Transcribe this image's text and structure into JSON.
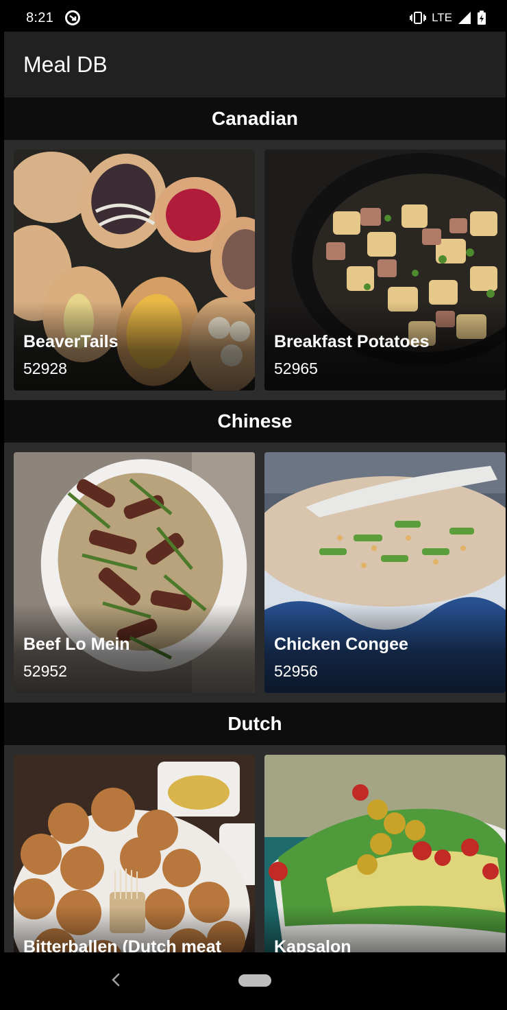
{
  "status_bar": {
    "time": "8:21",
    "network": "LTE",
    "icons": [
      "sync-icon",
      "vibrate-icon",
      "signal-icon",
      "battery-charging-icon"
    ]
  },
  "app_bar": {
    "title": "Meal DB"
  },
  "sections": [
    {
      "category": "Canadian",
      "meals": [
        {
          "name": "BeaverTails",
          "id": "52928"
        },
        {
          "name": "Breakfast Potatoes",
          "id": "52965"
        }
      ]
    },
    {
      "category": "Chinese",
      "meals": [
        {
          "name": "Beef Lo Mein",
          "id": "52952"
        },
        {
          "name": "Chicken Congee",
          "id": "52956"
        }
      ]
    },
    {
      "category": "Dutch",
      "meals": [
        {
          "name": "Bitterballen (Dutch meat",
          "id": ""
        },
        {
          "name": "Kapsalon",
          "id": ""
        }
      ]
    }
  ],
  "nav_bar": {
    "icons": [
      "back-icon",
      "home-pill"
    ]
  },
  "colors": {
    "background": "#2c2c2c",
    "app_bar": "#212121",
    "section_header": "#0d0d0d",
    "status_bar": "#000000"
  }
}
